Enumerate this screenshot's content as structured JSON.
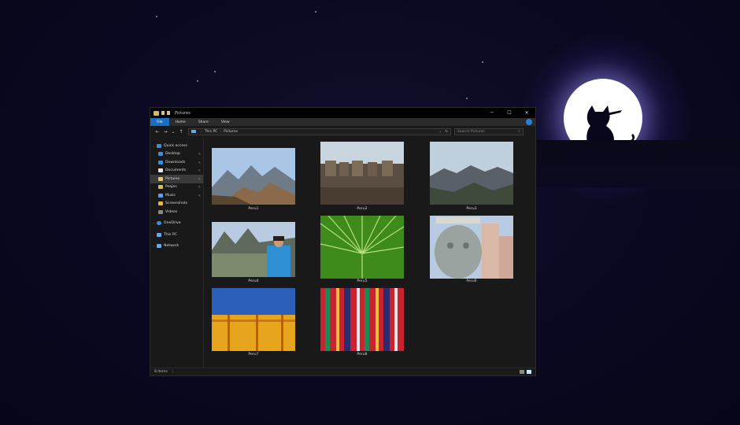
{
  "window": {
    "title": "Pictures",
    "controls": {
      "minimize": "─",
      "maximize": "☐",
      "close": "✕"
    }
  },
  "ribbon": {
    "tabs": [
      "File",
      "Home",
      "Share",
      "View"
    ]
  },
  "address": {
    "back": "←",
    "forward": "→",
    "recent": "⌄",
    "up": "↑",
    "path": [
      "This PC",
      "Pictures"
    ],
    "dropdown": "⌄",
    "refresh": "↻",
    "search_placeholder": "Search Pictures",
    "search_icon": "⌕"
  },
  "sidebar": {
    "quick_access": "Quick access",
    "items": [
      {
        "label": "Desktop",
        "pinned": true
      },
      {
        "label": "Downloads",
        "pinned": true
      },
      {
        "label": "Documents",
        "pinned": true
      },
      {
        "label": "Pictures",
        "pinned": true
      },
      {
        "label": "Peajes",
        "pinned": true
      },
      {
        "label": "Music",
        "pinned": true
      },
      {
        "label": "Screenshots",
        "pinned": false
      },
      {
        "label": "Videos",
        "pinned": false
      }
    ],
    "onedrive": "OneDrive",
    "thispc": "This PC",
    "network": "Network",
    "pin_glyph": "📌"
  },
  "files": [
    {
      "name": "Peru1"
    },
    {
      "name": "Peru2"
    },
    {
      "name": "Peru3"
    },
    {
      "name": "Peru4"
    },
    {
      "name": "Peru5"
    },
    {
      "name": "Peru6"
    },
    {
      "name": "Peru7"
    },
    {
      "name": "Peru8"
    }
  ],
  "status": {
    "count": "8 items"
  },
  "colors": {
    "accent": "#1a6fc4",
    "window_bg": "#191919",
    "titlebar_bg": "#000000"
  }
}
